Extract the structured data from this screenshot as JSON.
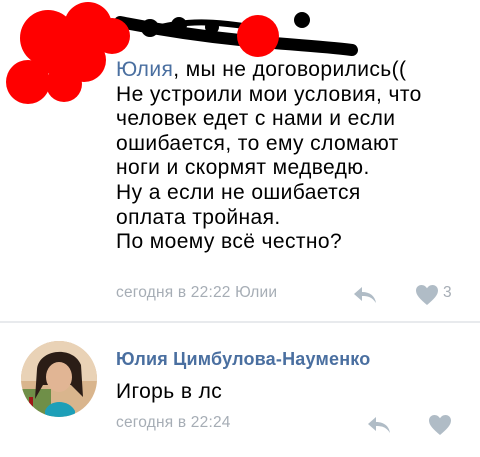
{
  "comment1": {
    "reply_to": "Юлия",
    "text_after_reply": ", мы не договорились((\nНе устроили мои условия, что\nчеловек едет с нами и если\nошибается, то ему сломают\nноги и скормят медведю.\nНу а если не ошибается\nоплата тройная.\nПо моему всё честно?",
    "timestamp": "сегодня в 22:22 Юлии",
    "like_count": "3",
    "icons": {
      "reply": "reply-icon",
      "like": "heart-icon"
    }
  },
  "comment2": {
    "author": "Юлия Цимбулова-Науменко",
    "text": "Игорь в лс",
    "timestamp": "сегодня в 22:24",
    "icons": {
      "reply": "reply-icon",
      "like": "heart-icon",
      "avatar": "avatar"
    }
  },
  "colors": {
    "link": "#4a6fa0",
    "meta": "#a6adb5",
    "icon": "#b0bcc6",
    "redaction_red": "#ff0000",
    "redaction_black": "#000000"
  }
}
